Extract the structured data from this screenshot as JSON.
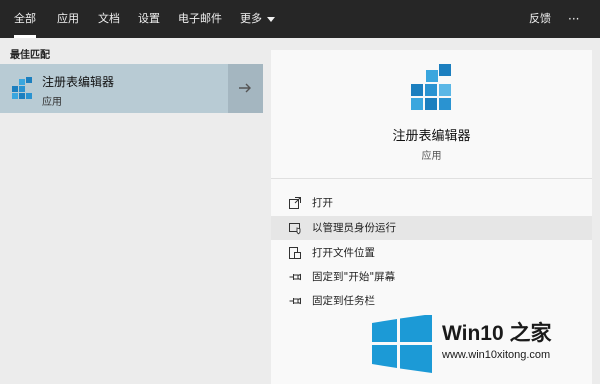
{
  "top_tabs": [
    {
      "label": "全部",
      "active": true
    },
    {
      "label": "应用"
    },
    {
      "label": "文档"
    },
    {
      "label": "设置"
    },
    {
      "label": "电子邮件"
    },
    {
      "label": "更多"
    }
  ],
  "top_right": {
    "feedback": "反馈",
    "more": "···"
  },
  "left": {
    "section_title": "最佳匹配",
    "best_match": {
      "name": "注册表编辑器",
      "type": "应用",
      "icon": "registry-editor-icon"
    }
  },
  "detail": {
    "name": "注册表编辑器",
    "type": "应用",
    "actions": [
      {
        "label": "打开",
        "icon": "open-icon"
      },
      {
        "label": "以管理员身份运行",
        "icon": "run-as-admin-icon"
      },
      {
        "label": "打开文件位置",
        "icon": "file-location-icon"
      },
      {
        "label": "固定到\"开始\"屏幕",
        "icon": "pin-start-icon"
      },
      {
        "label": "固定到任务栏",
        "icon": "pin-taskbar-icon"
      }
    ]
  },
  "watermark": {
    "title": "Win10 之家",
    "url": "www.win10xitong.com"
  },
  "colors": {
    "topbar": "#262626",
    "selected": "#b8cbd4",
    "accent_blue": "#1c9ad6"
  }
}
